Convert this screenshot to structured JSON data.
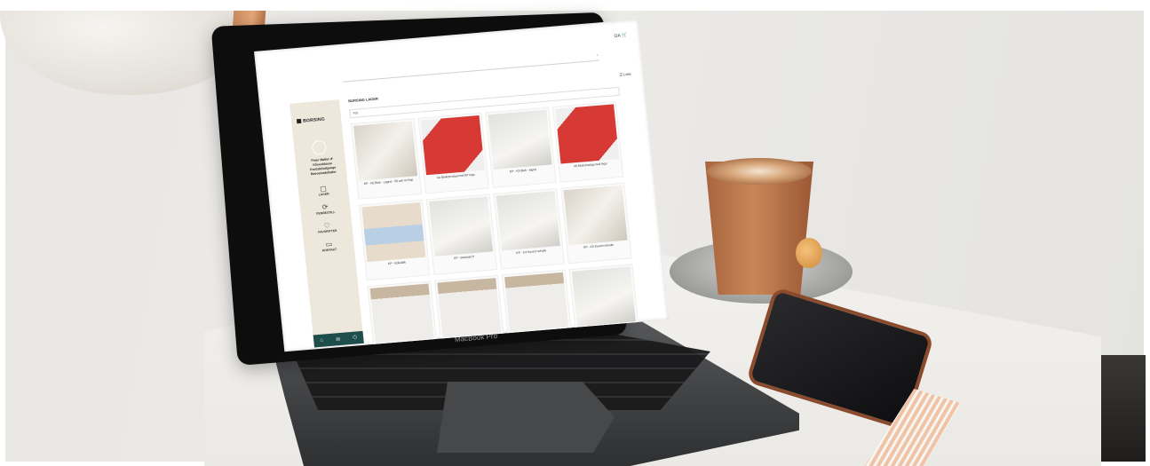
{
  "scene": {
    "colors": {
      "wall": "#e9e7e4",
      "table": "#efeeeb",
      "laptop_body": "#3d3e40",
      "coffee": "#b06b42",
      "sidebar_bg": "#ede7dc",
      "sidebar_footer": "#1d4e4b",
      "accent_red": "#d73a34"
    },
    "laptop_brand": "MacBook Pro"
  },
  "app": {
    "logo_text": "BORSING",
    "topbar": {
      "lang": "DA",
      "cart_icon": "cart-icon"
    },
    "search_icon": "search-icon",
    "sidebar": {
      "links": [
        "Peter Møller ✐",
        "Kåsesklasse",
        "Kontakt/adgange",
        "Nøvoekodellader"
      ],
      "nav": [
        {
          "icon": "box-icon",
          "glyph": "▢",
          "label": "LAGER"
        },
        {
          "icon": "refresh-icon",
          "glyph": "⟳",
          "label": "GENBESTILL"
        },
        {
          "icon": "heart-icon",
          "glyph": "♡",
          "label": "FAVORITTER"
        },
        {
          "icon": "comment-icon",
          "glyph": "▭",
          "label": "KONTAKT"
        }
      ],
      "footer_icons": [
        {
          "icon": "home-icon",
          "glyph": "⌂"
        },
        {
          "icon": "mail-icon",
          "glyph": "✉"
        },
        {
          "icon": "power-icon",
          "glyph": "⏻"
        }
      ]
    },
    "breadcrumb": "BORSING LAGER",
    "list_toggle": "☰ Liste",
    "filter_label": "Filt",
    "products": [
      {
        "label": "KP - A5 Blok - Lagret - 50 ark m/ linje",
        "style": "paper"
      },
      {
        "label": "A4 Blokomslag med KP logo",
        "style": "red"
      },
      {
        "label": "KP - A3 Blok - lagret",
        "style": "grey"
      },
      {
        "label": "A5 Blokomslag med logo",
        "style": "red"
      },
      {
        "label": "KP - Boksklik",
        "style": "box"
      },
      {
        "label": "KP - Bestsæt P",
        "style": "grey"
      },
      {
        "label": "KP - C4 Kuvert m/rude",
        "style": "grey"
      },
      {
        "label": "KP - C5 Kuvert m/rude",
        "style": "paper"
      },
      {
        "label": "",
        "style": "env"
      },
      {
        "label": "",
        "style": "env"
      },
      {
        "label": "",
        "style": "env"
      },
      {
        "label": "",
        "style": "grey"
      }
    ]
  }
}
